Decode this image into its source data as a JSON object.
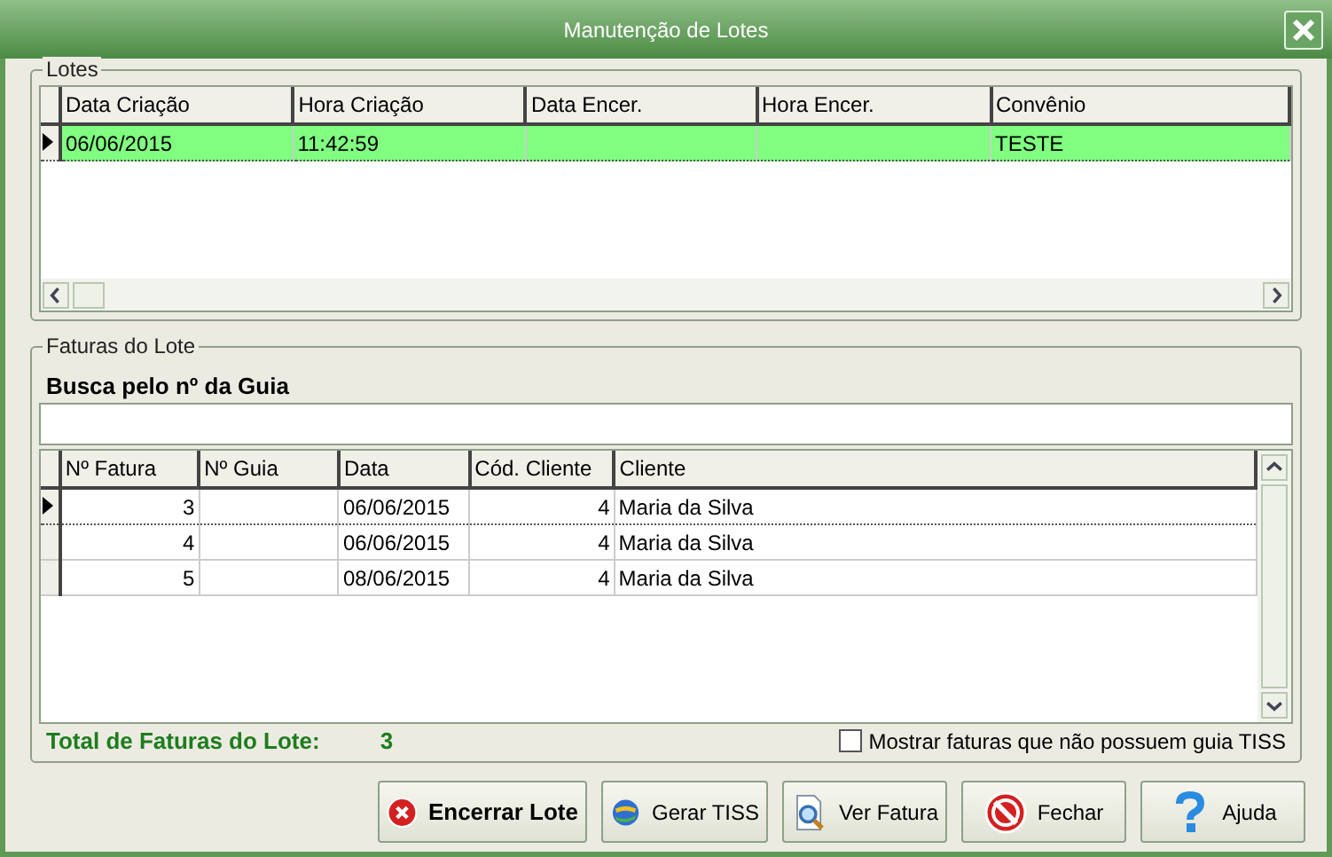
{
  "window": {
    "title": "Manutenção de Lotes"
  },
  "lotes": {
    "title": "Lotes",
    "columns": [
      "Data Criação",
      "Hora Criação",
      "Data Encer.",
      "Hora Encer.",
      "Convênio"
    ],
    "rows": [
      {
        "cells": [
          "06/06/2015",
          "11:42:59",
          "",
          "",
          "TESTE"
        ],
        "selected": true
      }
    ]
  },
  "faturas": {
    "title": "Faturas do Lote",
    "search": {
      "label": "Busca pelo nº da Guia"
    },
    "columns": [
      "Nº Fatura",
      "Nº Guia",
      "Data",
      "Cód. Cliente",
      "Cliente"
    ],
    "rows": [
      {
        "cells": [
          "3",
          "",
          "06/06/2015",
          "4",
          "Maria da Silva"
        ],
        "selected": true
      },
      {
        "cells": [
          "4",
          "",
          "06/06/2015",
          "4",
          "Maria da Silva"
        ],
        "selected": false
      },
      {
        "cells": [
          "5",
          "",
          "08/06/2015",
          "4",
          "Maria da Silva"
        ],
        "selected": false
      }
    ]
  },
  "total": {
    "label": "Total de Faturas do Lote:",
    "value": "3"
  },
  "show_without_tiss": {
    "label": "Mostrar faturas que não possuem guia TISS",
    "checked": false
  },
  "buttons": [
    {
      "label": "Encerrar Lote",
      "kind": "close",
      "bold": true
    },
    {
      "label": "Gerar TISS",
      "kind": "globe",
      "bold": false
    },
    {
      "label": "Ver Fatura",
      "kind": "preview",
      "bold": false
    },
    {
      "label": "Fechar",
      "kind": "stop",
      "bold": false
    },
    {
      "label": "Ajuda",
      "kind": "help",
      "bold": false
    }
  ]
}
